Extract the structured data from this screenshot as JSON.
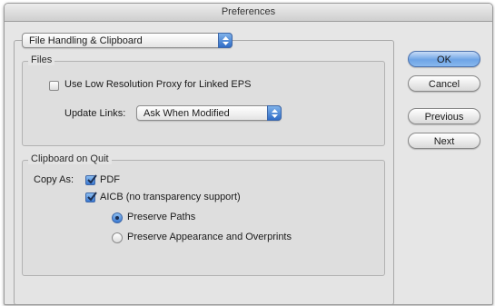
{
  "window": {
    "title": "Preferences"
  },
  "section_selector": {
    "value": "File Handling & Clipboard"
  },
  "files_group": {
    "label": "Files",
    "low_res_proxy": {
      "label": "Use Low Resolution Proxy for Linked EPS",
      "checked": false
    },
    "update_links": {
      "label": "Update Links:",
      "value": "Ask When Modified"
    }
  },
  "clipboard_group": {
    "label": "Clipboard on Quit",
    "copy_as_label": "Copy As:",
    "pdf": {
      "label": "PDF",
      "checked": true
    },
    "aicb": {
      "label": "AICB (no transparency support)",
      "checked": true
    },
    "preserve_paths": {
      "label": "Preserve Paths",
      "selected": true
    },
    "preserve_appearance": {
      "label": "Preserve Appearance and Overprints",
      "selected": false
    }
  },
  "buttons": {
    "ok": "OK",
    "cancel": "Cancel",
    "previous": "Previous",
    "next": "Next"
  },
  "colors": {
    "accent": "#3a78d2",
    "window_bg": "#e6e6e6"
  }
}
